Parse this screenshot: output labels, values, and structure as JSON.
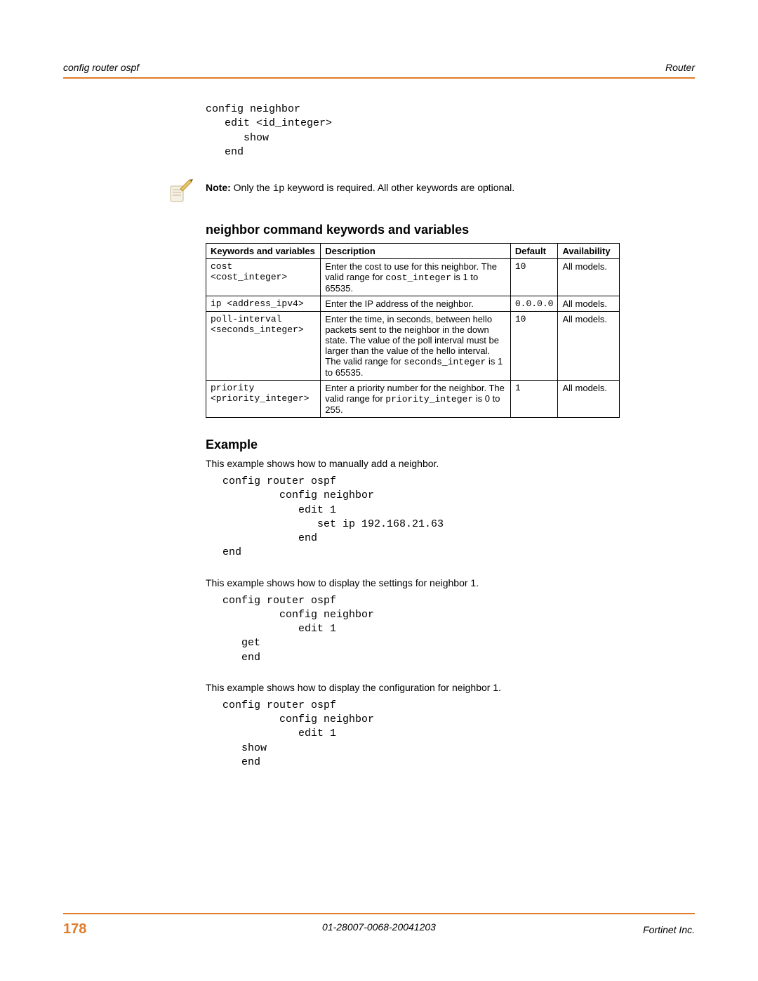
{
  "header": {
    "left": "config router ospf",
    "right": "Router"
  },
  "code1": "config neighbor\n   edit <id_integer>\n      show\n   end",
  "note": {
    "bold": "Note:",
    "pre": " Only the ",
    "kw": "ip",
    "post": " keyword is required. All other keywords are optional."
  },
  "tableTitle": "neighbor command keywords and variables",
  "tableHeaders": {
    "kw": "Keywords and variables",
    "desc": "Description",
    "def": "Default",
    "av": "Availability"
  },
  "rows": [
    {
      "kw": "cost\n<cost_integer>",
      "desc_pre": "Enter the cost to use for this neighbor. The valid range for ",
      "desc_mono": "cost_integer",
      "desc_post": " is 1 to 65535.",
      "def": "10",
      "av": "All models."
    },
    {
      "kw": "ip <address_ipv4>",
      "desc_pre": "Enter the IP address of the neighbor.",
      "desc_mono": "",
      "desc_post": "",
      "def": "0.0.0.0",
      "av": "All models."
    },
    {
      "kw": "poll-interval\n<seconds_integer>",
      "desc_pre": "Enter the time, in seconds, between hello packets sent to the neighbor in the down state. The value of the poll interval must be larger than the value of the hello interval. The valid range for ",
      "desc_mono": "seconds_integer",
      "desc_post": " is 1 to 65535.",
      "def": "10",
      "av": "All models."
    },
    {
      "kw": "priority\n<priority_integer>",
      "desc_pre": "Enter a priority number for the neighbor. The valid range for ",
      "desc_mono": "priority_integer",
      "desc_post": " is 0 to 255.",
      "def": "1",
      "av": "All models."
    }
  ],
  "exampleHeading": "Example",
  "para1": "This example shows how to manually add a neighbor.",
  "code2": "config router ospf\n         config neighbor\n            edit 1\n               set ip 192.168.21.63\n            end\nend",
  "para2": "This example shows how to display the settings for neighbor 1.",
  "code3": "config router ospf\n         config neighbor\n            edit 1\n   get\n   end",
  "para3": "This example shows how to display the configuration for neighbor 1.",
  "code4": "config router ospf\n         config neighbor\n            edit 1\n   show\n   end",
  "footer": {
    "page": "178",
    "center": "01-28007-0068-20041203",
    "right": "Fortinet Inc."
  }
}
